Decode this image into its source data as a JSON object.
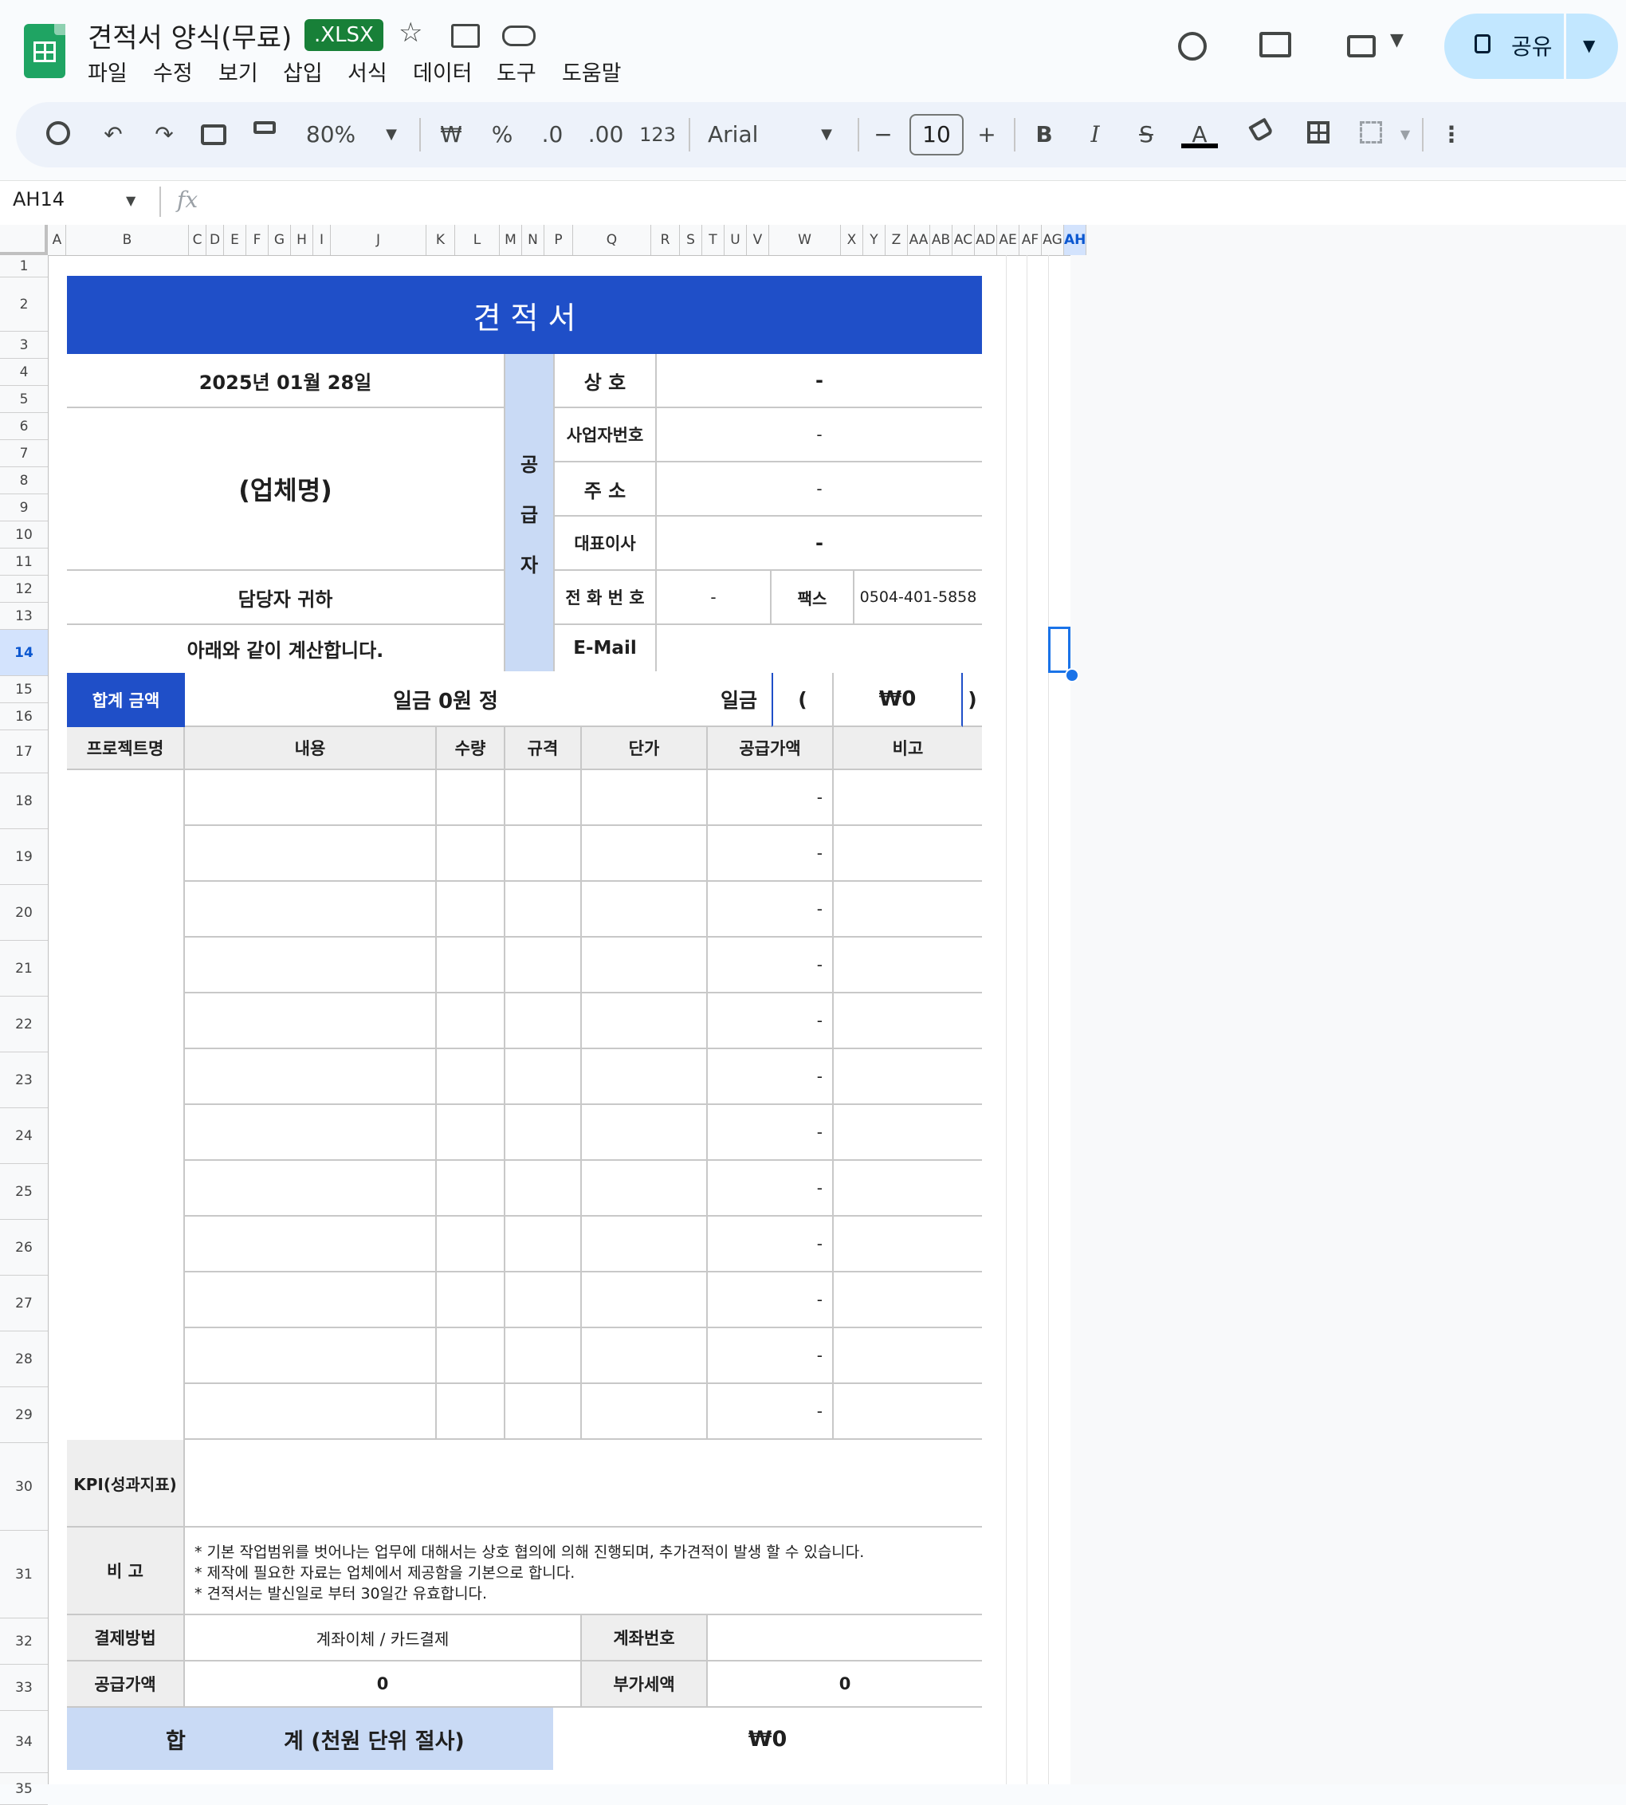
{
  "app": {
    "title": "견적서 양식(무료)",
    "file_badge": ".XLSX",
    "menu": [
      "파일",
      "수정",
      "보기",
      "삽입",
      "서식",
      "데이터",
      "도구",
      "도움말"
    ],
    "share_label": "공유"
  },
  "toolbar": {
    "zoom": "80%",
    "currency": "₩",
    "percent": "%",
    "dec_decrease": ".0",
    "dec_increase": ".00",
    "number_format": "123",
    "font": "Arial",
    "font_size": "10",
    "bold": "B",
    "italic": "I",
    "text_color": "A"
  },
  "formula_bar": {
    "cell_ref": "AH14",
    "fx": "fx",
    "value": ""
  },
  "columns": [
    "A",
    "B",
    "C",
    "D",
    "E",
    "F",
    "G",
    "H",
    "I",
    "J",
    "K",
    "L",
    "M",
    "N",
    "P",
    "Q",
    "R",
    "S",
    "T",
    "U",
    "V",
    "W",
    "X",
    "Y",
    "Z",
    "AA",
    "AB",
    "AC",
    "AD",
    "AE",
    "AF",
    "AG",
    "AH"
  ],
  "rows": [
    "1",
    "2",
    "3",
    "4",
    "5",
    "6",
    "7",
    "8",
    "9",
    "10",
    "11",
    "12",
    "13",
    "14",
    "15",
    "16",
    "17",
    "18",
    "19",
    "20",
    "21",
    "22",
    "23",
    "24",
    "25",
    "26",
    "27",
    "28",
    "29",
    "30",
    "31",
    "32",
    "33",
    "34",
    "35"
  ],
  "quote": {
    "title": "견 적 서",
    "date": "2025년 01월 28일",
    "client": "(업체명)",
    "attn": "담당자 귀하",
    "intro": "아래와 같이 계산합니다.",
    "supplier_label": [
      "공",
      "급",
      "자"
    ],
    "supplier": {
      "company_label": "상 호",
      "company": "-",
      "bizno_label": "사업자번호",
      "bizno": "-",
      "address_label": "주 소",
      "address": "-",
      "ceo_label": "대표이사",
      "ceo": "-",
      "phone_label": "전 화 번 호",
      "phone": "-",
      "fax_label": "팩스",
      "fax": "0504-401-5858",
      "email_label": "E-Mail",
      "email": ""
    },
    "total_label": "합계 금액",
    "total_korean": "일금 0원 정",
    "total_prefix": "일금",
    "paren_open": "(",
    "total_number": "₩0",
    "paren_close": ")",
    "item_headers": [
      "프로젝트명",
      "내용",
      "수량",
      "규격",
      "단가",
      "공급가액",
      "비고"
    ],
    "item_supply_values": [
      "-",
      "-",
      "-",
      "-",
      "-",
      "-",
      "-",
      "-",
      "-",
      "-",
      "-",
      "-"
    ],
    "kpi_label": "KPI(성과지표)",
    "notes_label": "비 고",
    "notes": [
      "* 기본 작업범위를 벗어나는 업무에 대해서는 상호 협의에 의해 진행되며, 추가견적이 발생 할 수 있습니다.",
      "* 제작에 필요한 자료는 업체에서 제공함을 기본으로 합니다.",
      "* 견적서는 발신일로 부터 30일간 유효합니다."
    ],
    "payment_label": "결제방법",
    "payment": "계좌이체 / 카드결제",
    "account_label": "계좌번호",
    "account": "",
    "supply_label": "공급가액",
    "supply_value": "0",
    "vat_label": "부가세액",
    "vat_value": "0",
    "sum_label_1": "합",
    "sum_label_2": "계 (천원 단위 절사)",
    "sum_value": "₩0"
  },
  "colors": {
    "header_blue": "#1f4fc8",
    "light_blue": "#c9daf5",
    "gray": "#eeeeee",
    "selection": "#1a73e8"
  }
}
